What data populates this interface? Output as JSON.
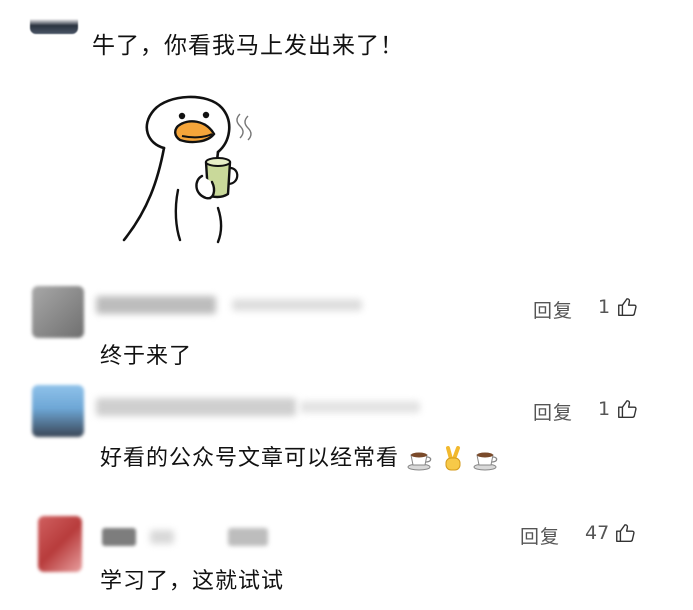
{
  "top_comment": {
    "text": "牛了，你看我马上发出来了！"
  },
  "sticker": {
    "icon": "duck-sipping-tea-sticker"
  },
  "comments": [
    {
      "text": "终于来了",
      "reply_label": "回复",
      "like_count": "1",
      "avatar_colors": [
        "#9a9a9a",
        "#6f6f6f"
      ]
    },
    {
      "text": "好看的公众号文章可以经常看",
      "emojis": [
        "coffee-cup-icon",
        "victory-hand-icon",
        "coffee-cup-icon"
      ],
      "reply_label": "回复",
      "like_count": "1",
      "avatar_colors": [
        "#6fa8d8",
        "#3b4a5c"
      ]
    },
    {
      "text": "学习了，这就试试",
      "reply_label": "回复",
      "like_count": "47",
      "avatar_colors": [
        "#c94a4a",
        "#e07f7f"
      ]
    }
  ]
}
